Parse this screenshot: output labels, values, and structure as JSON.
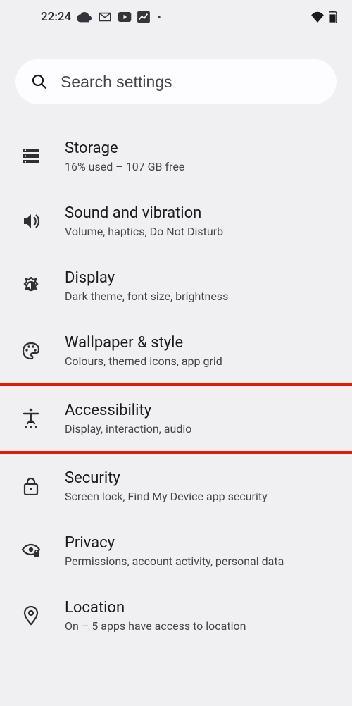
{
  "status": {
    "time": "22:24"
  },
  "search": {
    "placeholder": "Search settings"
  },
  "items": [
    {
      "title": "Storage",
      "sub": "16% used – 107 GB free"
    },
    {
      "title": "Sound and vibration",
      "sub": "Volume, haptics, Do Not Disturb"
    },
    {
      "title": "Display",
      "sub": "Dark theme, font size, brightness"
    },
    {
      "title": "Wallpaper & style",
      "sub": "Colours, themed icons, app grid"
    },
    {
      "title": "Accessibility",
      "sub": "Display, interaction, audio"
    },
    {
      "title": "Security",
      "sub": "Screen lock, Find My Device app security"
    },
    {
      "title": "Privacy",
      "sub": "Permissions, account activity, personal data"
    },
    {
      "title": "Location",
      "sub": "On – 5 apps have access to location"
    }
  ]
}
